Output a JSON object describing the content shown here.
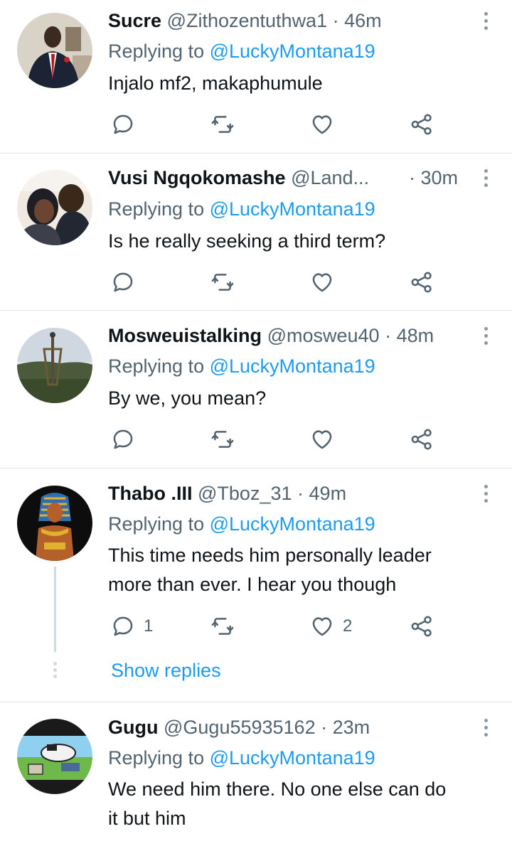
{
  "tweets": [
    {
      "name": "Sucre",
      "handle": "@Zithozentuthwa1",
      "dot": "·",
      "time": "46m",
      "replying_prefix": "Replying to",
      "replying_to": "@LuckyMontana19",
      "lines": [
        "Injalo mf2, makaphumule"
      ],
      "reply_count": "",
      "like_count": ""
    },
    {
      "name": "Vusi Ngqokomashe",
      "handle": "@Land...",
      "dot": "·",
      "time": "30m",
      "replying_prefix": "Replying to",
      "replying_to": "@LuckyMontana19",
      "lines": [
        "Is he really seeking a third term?"
      ],
      "reply_count": "",
      "like_count": ""
    },
    {
      "name": "Mosweuistalking",
      "handle": "@mosweu40",
      "dot": "·",
      "time": "48m",
      "replying_prefix": "Replying to",
      "replying_to": "@LuckyMontana19",
      "lines": [
        "By we, you mean?"
      ],
      "reply_count": "",
      "like_count": ""
    },
    {
      "name": "Thabo .III",
      "handle": "@Tboz_31",
      "dot": "·",
      "time": "49m",
      "replying_prefix": "Replying to",
      "replying_to": "@LuckyMontana19",
      "lines": [
        "This time needs him personally leader",
        "more than ever. I hear you though"
      ],
      "reply_count": "1",
      "like_count": "2",
      "show_replies": "Show replies"
    },
    {
      "name": "Gugu",
      "handle": "@Gugu55935162",
      "dot": "·",
      "time": "23m",
      "replying_prefix": "Replying to",
      "replying_to": "@LuckyMontana19",
      "lines": [
        "We need him there. No one else can do",
        "it but him"
      ],
      "reply_count": "",
      "like_count": ""
    }
  ],
  "icons": {
    "reply": "reply-icon",
    "retweet": "retweet-icon",
    "like": "heart-icon",
    "share": "share-icon",
    "more": "more-options-icon"
  },
  "colors": {
    "link": "#1d9bf0",
    "secondary_text": "#536471",
    "divider": "#e1e6ea"
  }
}
